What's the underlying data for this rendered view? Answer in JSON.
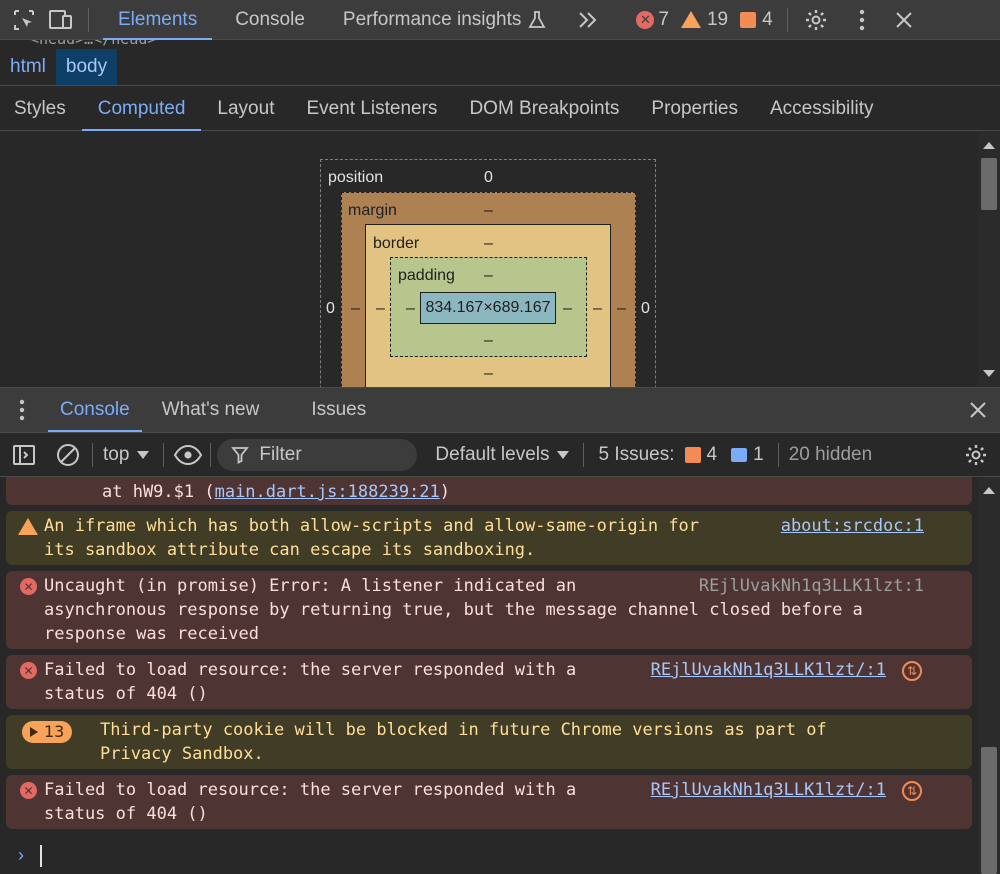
{
  "top_tabs": [
    {
      "label": "Elements",
      "active": true
    },
    {
      "label": "Console",
      "active": false
    },
    {
      "label": "Performance insights",
      "active": false
    }
  ],
  "counts": {
    "errors": "7",
    "warnings": "19",
    "issues": "4"
  },
  "dom_line_fragment": "<head>…</head>",
  "breadcrumb": [
    "html",
    "body"
  ],
  "sub_tabs": [
    "Styles",
    "Computed",
    "Layout",
    "Event Listeners",
    "DOM Breakpoints",
    "Properties",
    "Accessibility"
  ],
  "box_model": {
    "position_label": "position",
    "position_value": "0",
    "margin_label": "margin",
    "margin_value": "–",
    "border_label": "border",
    "border_value": "–",
    "padding_label": "padding",
    "padding_value": "–",
    "content_size": "834.167×689.167",
    "left_outer": "0",
    "right_outer": "0",
    "dash": "–"
  },
  "drawer_tabs": [
    {
      "label": "Console",
      "active": true
    },
    {
      "label": "What's new",
      "active": false
    },
    {
      "label": "Issues",
      "active": false
    }
  ],
  "console_toolbar": {
    "context": "top",
    "filter_placeholder": "Filter",
    "levels": "Default levels",
    "issues_label": "5 Issues:",
    "issues_warn": "4",
    "issues_info": "1",
    "hidden": "20 hidden"
  },
  "messages": [
    {
      "type": "error-tail",
      "text": "at hW9.$1 (",
      "link": "main.dart.js:188239:21",
      "text_after": ")"
    },
    {
      "type": "warn",
      "line1": "An iframe which has both allow-scripts and allow-same-origin for",
      "line2": "its sandbox attribute can escape its sandboxing.",
      "source": "about:srcdoc:1"
    },
    {
      "type": "error",
      "line1": "Uncaught (in promise) Error: A listener indicated an",
      "line2": "asynchronous response by returning true, but the message channel closed before a",
      "line3": "response was received",
      "source": "REjlUvakNh1q3LLK1lzt:1"
    },
    {
      "type": "error",
      "line1": "Failed to load resource: the server responded with a",
      "line2": "status of 404 ()",
      "source": "REjlUvakNh1q3LLK1lzt/:1"
    },
    {
      "type": "warn-group",
      "count": "13",
      "line1": "Third-party cookie will be blocked in future Chrome versions as part of",
      "line2": "Privacy Sandbox."
    },
    {
      "type": "error",
      "line1": "Failed to load resource: the server responded with a",
      "line2": "status of 404 ()",
      "source": "REjlUvakNh1q3LLK1lzt/:1"
    }
  ],
  "prompt_symbol": "›"
}
